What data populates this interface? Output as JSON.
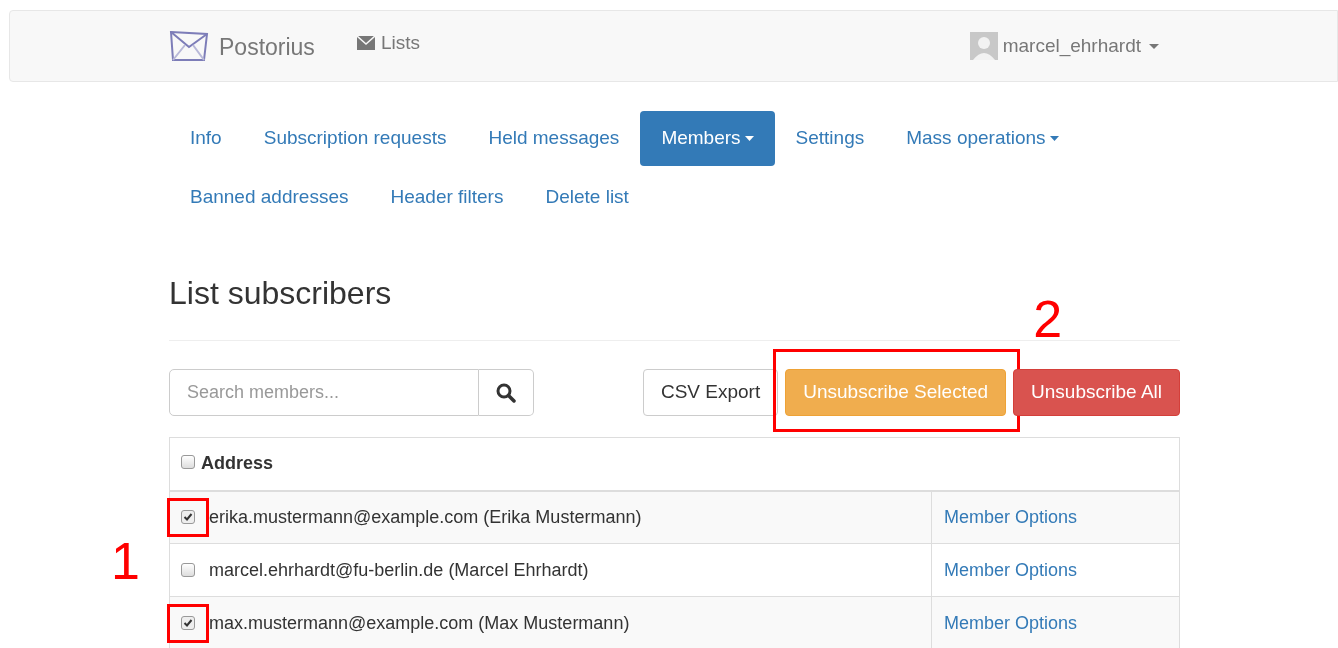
{
  "navbar": {
    "brand": "Postorius",
    "links": [
      {
        "label": "Lists"
      }
    ],
    "user": "marcel_ehrhardt"
  },
  "tabs": [
    {
      "label": "Info",
      "selected": false,
      "dropdown": false
    },
    {
      "label": "Subscription requests",
      "selected": false,
      "dropdown": false
    },
    {
      "label": "Held messages",
      "selected": false,
      "dropdown": false
    },
    {
      "label": "Members",
      "selected": true,
      "dropdown": true
    },
    {
      "label": "Settings",
      "selected": false,
      "dropdown": false
    },
    {
      "label": "Mass operations",
      "selected": false,
      "dropdown": true
    },
    {
      "label": "Banned addresses",
      "selected": false,
      "dropdown": false
    },
    {
      "label": "Header filters",
      "selected": false,
      "dropdown": false
    },
    {
      "label": "Delete list",
      "selected": false,
      "dropdown": false
    }
  ],
  "heading": "List subscribers",
  "search": {
    "placeholder": "Search members..."
  },
  "buttons": [
    {
      "label": "CSV Export",
      "kind": "default",
      "highlighted": false
    },
    {
      "label": "Unsubscribe Selected",
      "kind": "warning",
      "highlighted": true,
      "annotation": "2"
    },
    {
      "label": "Unsubscribe All",
      "kind": "danger",
      "highlighted": false
    }
  ],
  "table": {
    "header": {
      "label": "Address",
      "checked": false
    },
    "rows": [
      {
        "address": "erika.mustermann@example.com (Erika Mustermann)",
        "checked": true,
        "highlighted": true,
        "link": "Member Options"
      },
      {
        "address": "marcel.ehrhardt@fu-berlin.de (Marcel Ehrhardt)",
        "checked": false,
        "highlighted": false,
        "link": "Member Options",
        "annotation": "1"
      },
      {
        "address": "max.mustermann@example.com (Max Mustermann)",
        "checked": true,
        "highlighted": true,
        "link": "Member Options"
      }
    ]
  }
}
